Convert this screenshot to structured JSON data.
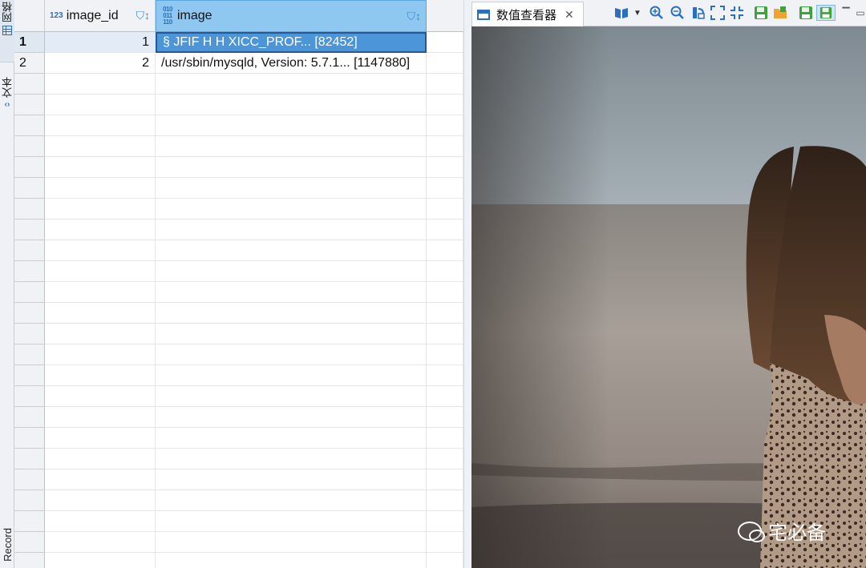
{
  "side_tabs": {
    "grid_label": "网格",
    "text_label": "文本",
    "record_label": "Record"
  },
  "grid": {
    "columns": [
      {
        "type_badge": "123",
        "name": "image_id"
      },
      {
        "type_badge": "010\n011\n110",
        "name": "image"
      }
    ],
    "rows": [
      {
        "row_number": "1",
        "image_id": "1",
        "image": "§  JFIF     H H   XICC_PROF... [82452]"
      },
      {
        "row_number": "2",
        "image_id": "2",
        "image": "/usr/sbin/mysqld, Version: 5.7.1... [1147880]"
      }
    ]
  },
  "viewer": {
    "tab_title": "数值查看器",
    "watermark_text": "宅必备"
  },
  "colors": {
    "header_selected": "#8ec7ef",
    "cell_selected": "#4b95d8",
    "accent": "#2b6fc2"
  }
}
